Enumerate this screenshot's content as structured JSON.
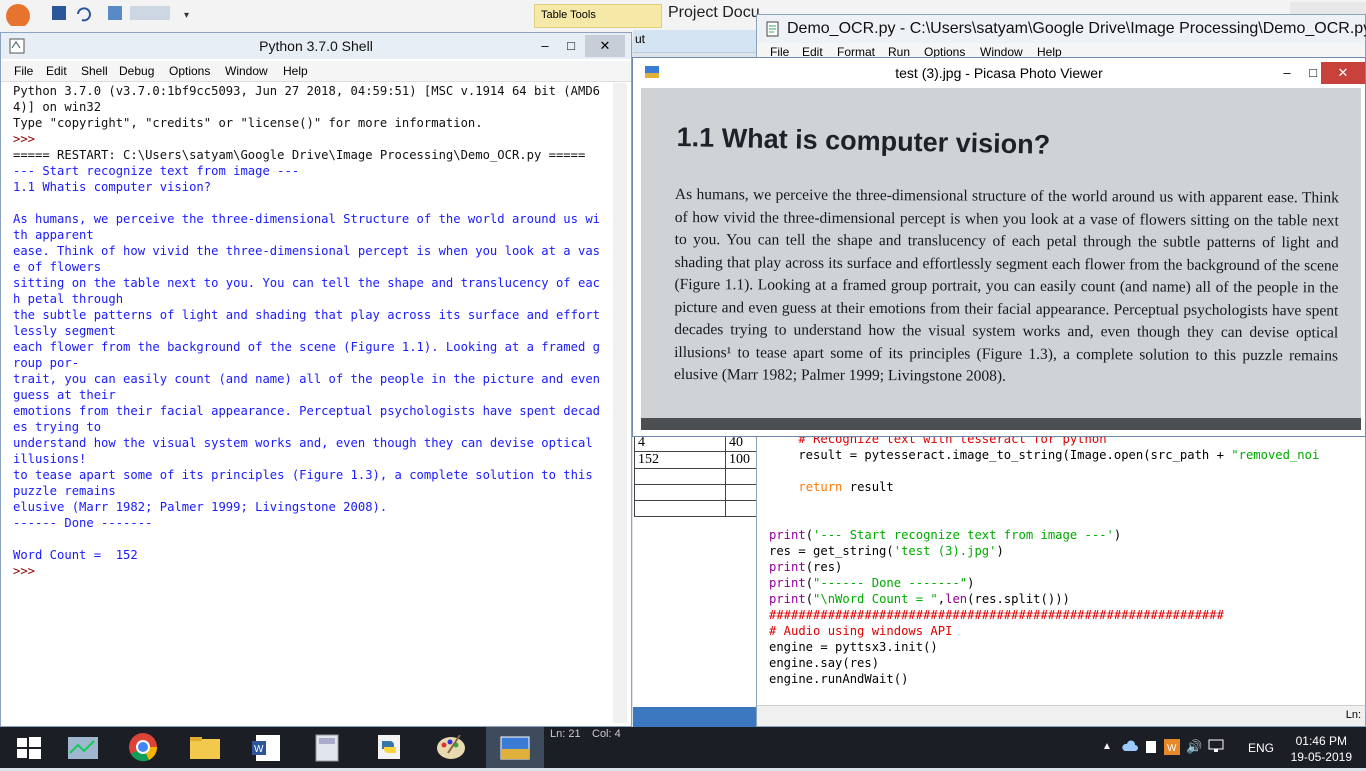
{
  "word": {
    "table_tools": "Table Tools",
    "title_partial": "Project Docu",
    "ribbon_fragment": "ut",
    "table_rows": [
      [
        "4",
        "40"
      ],
      [
        "152",
        "100"
      ],
      [
        "",
        ""
      ],
      [
        "",
        ""
      ],
      [
        "",
        ""
      ]
    ]
  },
  "shell": {
    "title": "Python 3.7.0 Shell",
    "menu": [
      "File",
      "Edit",
      "Shell",
      "Debug",
      "Options",
      "Window",
      "Help"
    ],
    "lines": [
      {
        "t": "Python 3.7.0 (v3.7.0:1bf9cc5093, Jun 27 2018, 04:59:51) [MSC v.1914 64 bit (AMD64)] on win32",
        "c": "dark"
      },
      {
        "t": "Type \"copyright\", \"credits\" or \"license()\" for more information.",
        "c": "dark"
      },
      {
        "t": ">>> ",
        "c": "maroon"
      },
      {
        "t": "===== RESTART: C:\\Users\\satyam\\Google Drive\\Image Processing\\Demo_OCR.py =====",
        "c": "dark"
      },
      {
        "t": "--- Start recognize text from image ---",
        "c": "blue"
      },
      {
        "t": "1.1 Whatis computer vision?",
        "c": "blue"
      },
      {
        "t": "",
        "c": "blue"
      },
      {
        "t": "As humans, we perceive the three-dimensional Structure of the world around us with apparent",
        "c": "blue"
      },
      {
        "t": "ease. Think of how vivid the three-dimensional percept is when you look at a vase of flowers",
        "c": "blue"
      },
      {
        "t": "sitting on the table next to you. You can tell the shape and translucency of each petal through",
        "c": "blue"
      },
      {
        "t": "the subtle patterns of light and shading that play across its surface and effortlessly segment",
        "c": "blue"
      },
      {
        "t": "each flower from the background of the scene (Figure 1.1). Looking at a framed group por-",
        "c": "blue"
      },
      {
        "t": "trait, you can easily count (and name) all of the people in the picture and even guess at their",
        "c": "blue"
      },
      {
        "t": "emotions from their facial appearance. Perceptual psychologists have spent decades trying to",
        "c": "blue"
      },
      {
        "t": "understand how the visual system works and, even though they can devise optical illusions!",
        "c": "blue"
      },
      {
        "t": "to tease apart some of its principles (Figure 1.3), a complete solution to this puzzle remains",
        "c": "blue"
      },
      {
        "t": "elusive (Marr 1982; Palmer 1999; Livingstone 2008).",
        "c": "blue"
      },
      {
        "t": "------ Done -------",
        "c": "blue"
      },
      {
        "t": "",
        "c": "blue"
      },
      {
        "t": "Word Count =  152",
        "c": "blue"
      },
      {
        "t": ">>> ",
        "c": "maroon"
      }
    ],
    "status_line": "Ln: 21",
    "status_col": "Col: 4"
  },
  "editor": {
    "title": "Demo_OCR.py - C:\\Users\\satyam\\Google Drive\\Image Processing\\Demo_OCR.py ...",
    "menu": [
      "File",
      "Edit",
      "Format",
      "Run",
      "Options",
      "Window",
      "Help"
    ],
    "code": [
      {
        "segs": [
          [
            "    ",
            ""
          ],
          [
            "# Recognize text with tesseract for python",
            "cm"
          ]
        ]
      },
      {
        "segs": [
          [
            "    result = pytesseract.image_to_string(Image.open(src_path + ",
            ""
          ],
          [
            "\"removed_noi",
            "str"
          ]
        ]
      },
      {
        "segs": [
          [
            "",
            ""
          ]
        ]
      },
      {
        "segs": [
          [
            "    ",
            ""
          ],
          [
            "return",
            "kw"
          ],
          [
            " result",
            ""
          ]
        ]
      },
      {
        "segs": [
          [
            "",
            ""
          ]
        ]
      },
      {
        "segs": [
          [
            "",
            ""
          ]
        ]
      },
      {
        "segs": [
          [
            "print",
            "bi"
          ],
          [
            "(",
            ""
          ],
          [
            "'--- Start recognize text from image ---'",
            "str"
          ],
          [
            ")",
            ""
          ]
        ]
      },
      {
        "segs": [
          [
            "res = get_string(",
            ""
          ],
          [
            "'test (3).jpg'",
            "str"
          ],
          [
            ")",
            ""
          ]
        ]
      },
      {
        "segs": [
          [
            "print",
            "bi"
          ],
          [
            "(res)",
            ""
          ]
        ]
      },
      {
        "segs": [
          [
            "print",
            "bi"
          ],
          [
            "(",
            ""
          ],
          [
            "\"------ Done -------\"",
            "str"
          ],
          [
            ")",
            ""
          ]
        ]
      },
      {
        "segs": [
          [
            "print",
            "bi"
          ],
          [
            "(",
            ""
          ],
          [
            "\"\\nWord Count = \"",
            "str"
          ],
          [
            ",",
            ""
          ],
          [
            "len",
            "bi"
          ],
          [
            "(res.split()))",
            ""
          ]
        ]
      },
      {
        "segs": [
          [
            "##############################################################",
            "cm"
          ]
        ]
      },
      {
        "segs": [
          [
            "# Audio using windows API",
            "cm"
          ]
        ]
      },
      {
        "segs": [
          [
            "engine = pyttsx3.init()",
            ""
          ]
        ]
      },
      {
        "segs": [
          [
            "engine.say(res)",
            ""
          ]
        ]
      },
      {
        "segs": [
          [
            "engine.runAndWait()",
            ""
          ]
        ]
      }
    ],
    "status": "Ln:"
  },
  "picasa": {
    "title": "test (3).jpg - Picasa Photo Viewer",
    "heading": "1.1  What is computer vision?",
    "paragraph": "As humans, we perceive the three-dimensional structure of the world around us with apparent ease. Think of how vivid the three-dimensional percept is when you look at a vase of flowers sitting on the table next to you. You can tell the shape and translucency of each petal through the subtle patterns of light and shading that play across its surface and effortlessly segment each flower from the background of the scene (Figure 1.1). Looking at a framed group portrait, you can easily count (and name) all of the people in the picture and even guess at their emotions from their facial appearance. Perceptual psychologists have spent decades trying to understand how the visual system works and, even though they can devise optical illusions¹ to tease apart some of its principles (Figure 1.3), a complete solution to this puzzle remains elusive (Marr 1982; Palmer 1999; Livingstone 2008)."
  },
  "taskbar": {
    "apps": [
      "start-button",
      "task-manager",
      "chrome",
      "file-explorer",
      "word",
      "calculator",
      "python-idle",
      "paint",
      "picasa"
    ],
    "language": "ENG",
    "time": "01:46 PM",
    "date": "19-05-2019"
  },
  "colors": {
    "shell_output": "#1a1aff",
    "taskbar": "#1b1f25",
    "close_button": "#c8413b"
  }
}
